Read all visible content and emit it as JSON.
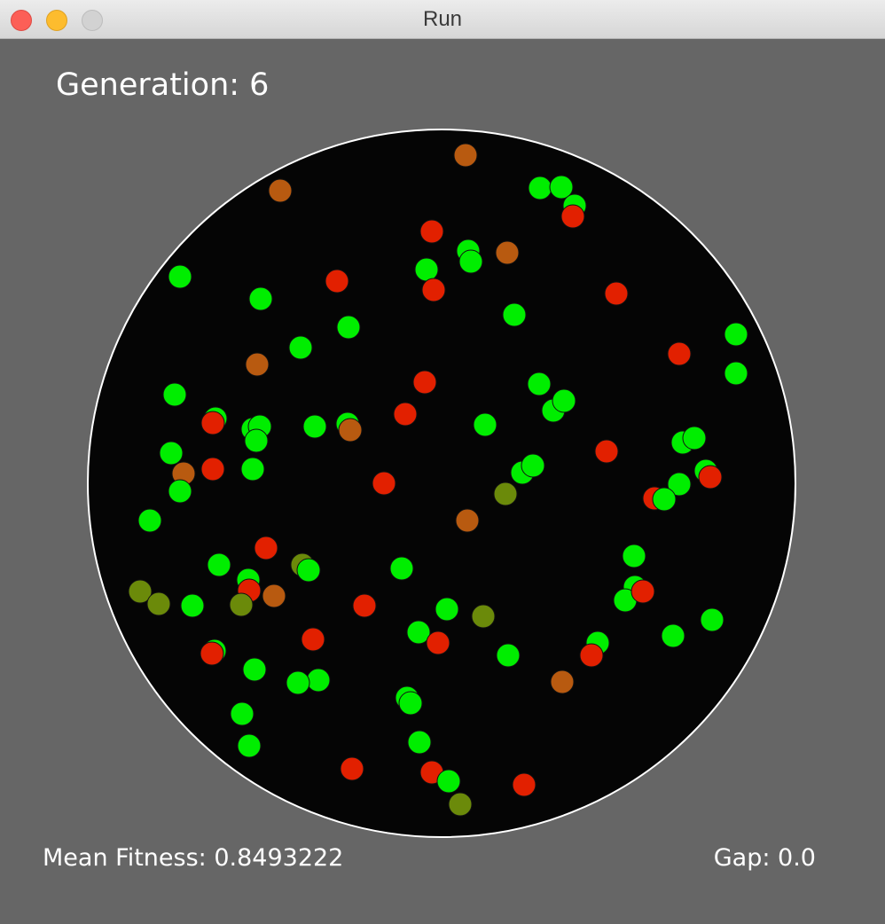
{
  "window": {
    "title": "Run"
  },
  "hud": {
    "generation_label": "Generation: ",
    "generation_value": "6",
    "mean_fitness_label": "Mean Fitness: ",
    "mean_fitness_value": "0.8493222",
    "gap_label": "Gap: ",
    "gap_value": "0.0"
  },
  "colors": {
    "background": "#666666",
    "arena": "#050505",
    "arena_border": "#ffffff",
    "agent_green": "#00ee00",
    "agent_red": "#e22000",
    "agent_orange": "#b85a10",
    "agent_olive": "#6b8a0a",
    "agent_outline": "#111111"
  },
  "icons": {
    "close": "close-icon",
    "minimize": "minimize-icon",
    "zoom": "zoom-icon"
  }
}
